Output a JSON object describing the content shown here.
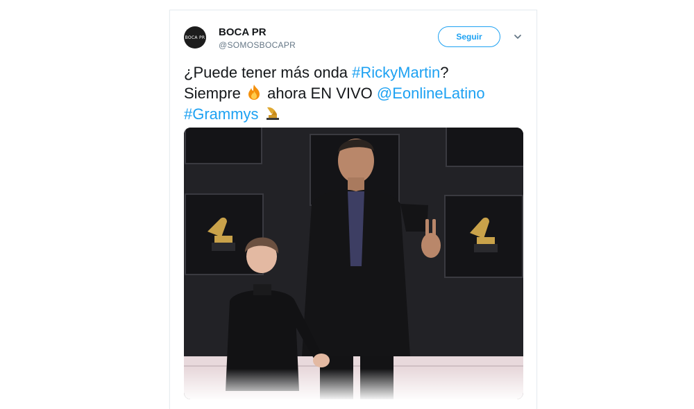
{
  "tweet": {
    "avatar_text": "BOCA PR",
    "display_name": "BOCA PR",
    "handle": "@SOMOSBOCAPR",
    "follow_label": "Seguir",
    "text": {
      "l1_prefix": "¿Puede tener más onda ",
      "hashtag_ricky": "#RickyMartin",
      "l1_suffix": "?",
      "l2_prefix": "Siempre ",
      "l2_middle": " ahora EN VIVO ",
      "mention": "@EonlineLatino",
      "hashtag_grammys": "#Grammys"
    },
    "icons": {
      "fire": "fire-emoji-icon",
      "grammy": "gramophone-emoji-icon",
      "chevron": "chevron-down-icon"
    }
  },
  "colors": {
    "link": "#1da1f2",
    "text": "#14171a",
    "muted": "#657786"
  }
}
